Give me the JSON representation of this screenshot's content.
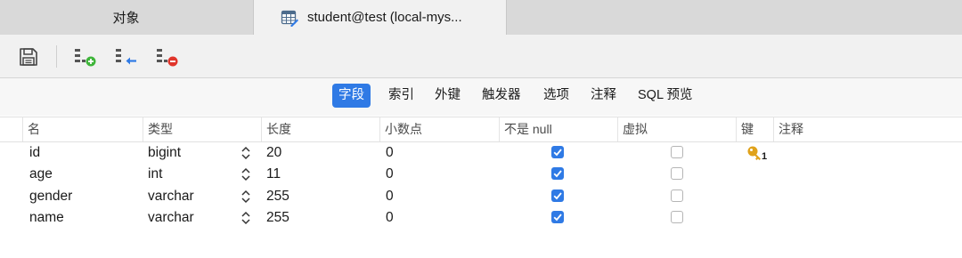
{
  "tabs": {
    "objects_label": "对象",
    "table_label": "student@test (local-mys..."
  },
  "toolbar": {
    "buttons": [
      "save-icon",
      "add-field-icon",
      "insert-field-icon",
      "delete-field-icon"
    ]
  },
  "subtabs": {
    "items": [
      "字段",
      "索引",
      "外键",
      "触发器",
      "选项",
      "注释",
      "SQL 预览"
    ],
    "selected": "字段"
  },
  "columns": {
    "name": "名",
    "type": "类型",
    "length": "长度",
    "decimals": "小数点",
    "not_null": "不是 null",
    "virtual": "虚拟",
    "key": "键",
    "comment": "注释"
  },
  "rows": [
    {
      "name": "id",
      "type": "bigint",
      "length": "20",
      "decimals": "0",
      "not_null": true,
      "virtual": false,
      "key": "1"
    },
    {
      "name": "age",
      "type": "int",
      "length": "11",
      "decimals": "0",
      "not_null": true,
      "virtual": false,
      "key": ""
    },
    {
      "name": "gender",
      "type": "varchar",
      "length": "255",
      "decimals": "0",
      "not_null": true,
      "virtual": false,
      "key": ""
    },
    {
      "name": "name",
      "type": "varchar",
      "length": "255",
      "decimals": "0",
      "not_null": true,
      "virtual": false,
      "key": ""
    }
  ],
  "colors": {
    "accent": "#2f7ae5",
    "key_icon": "#e0a21b",
    "add_green": "#3fb53a",
    "delete_red": "#e0352b",
    "insert_blue": "#2f7ae5"
  }
}
